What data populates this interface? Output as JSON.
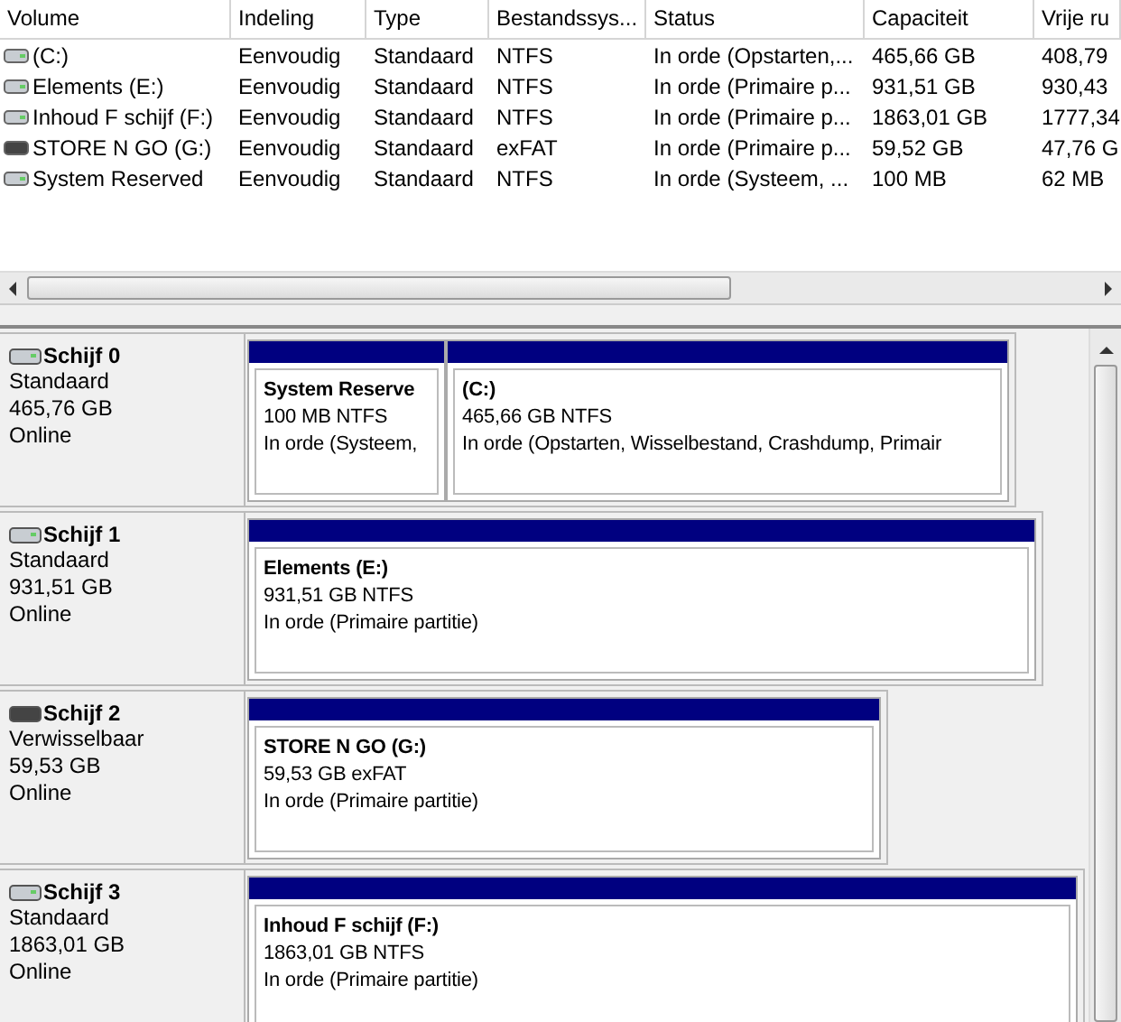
{
  "table": {
    "columns": [
      "Volume",
      "Indeling",
      "Type",
      "Bestandssys...",
      "Status",
      "Capaciteit",
      "Vrije ru"
    ],
    "rows": [
      {
        "kind": "fixed",
        "cells": [
          " (C:)",
          "Eenvoudig",
          "Standaard",
          "NTFS",
          "In orde (Opstarten,...",
          "465,66 GB",
          "408,79"
        ]
      },
      {
        "kind": "fixed",
        "cells": [
          "Elements (E:)",
          "Eenvoudig",
          "Standaard",
          "NTFS",
          "In orde (Primaire p...",
          "931,51 GB",
          "930,43"
        ]
      },
      {
        "kind": "fixed",
        "cells": [
          "Inhoud F schijf (F:)",
          "Eenvoudig",
          "Standaard",
          "NTFS",
          "In orde (Primaire p...",
          "1863,01 GB",
          "1777,34"
        ]
      },
      {
        "kind": "removable",
        "cells": [
          "STORE N GO (G:)",
          "Eenvoudig",
          "Standaard",
          "exFAT",
          "In orde (Primaire p...",
          "59,52 GB",
          "47,76 G"
        ]
      },
      {
        "kind": "fixed",
        "cells": [
          "System Reserved",
          "Eenvoudig",
          "Standaard",
          "NTFS",
          "In orde (Systeem, ...",
          "100 MB",
          "62 MB"
        ]
      }
    ]
  },
  "disks": [
    {
      "name": "Schijf 0",
      "kind": "fixed",
      "type": "Standaard",
      "size": "465,76 GB",
      "status": "Online",
      "partitions": [
        {
          "name": "System Reserve",
          "size": "100 MB NTFS",
          "status": "In orde (Systeem,"
        },
        {
          "name": " (C:)",
          "size": "465,66 GB NTFS",
          "status": "In orde (Opstarten, Wisselbestand, Crashdump, Primair"
        }
      ]
    },
    {
      "name": "Schijf 1",
      "kind": "fixed",
      "type": "Standaard",
      "size": "931,51 GB",
      "status": "Online",
      "partitions": [
        {
          "name": "Elements  (E:)",
          "size": "931,51 GB NTFS",
          "status": "In orde (Primaire partitie)"
        }
      ]
    },
    {
      "name": "Schijf 2",
      "kind": "removable",
      "type": "Verwisselbaar",
      "size": "59,53 GB",
      "status": "Online",
      "partitions": [
        {
          "name": "STORE N GO  (G:)",
          "size": "59,53 GB exFAT",
          "status": "In orde (Primaire partitie)"
        }
      ]
    },
    {
      "name": "Schijf 3",
      "kind": "fixed",
      "type": "Standaard",
      "size": "1863,01 GB",
      "status": "Online",
      "partitions": [
        {
          "name": "Inhoud F schijf  (F:)",
          "size": "1863,01 GB NTFS",
          "status": "In orde (Primaire partitie)"
        }
      ]
    }
  ]
}
